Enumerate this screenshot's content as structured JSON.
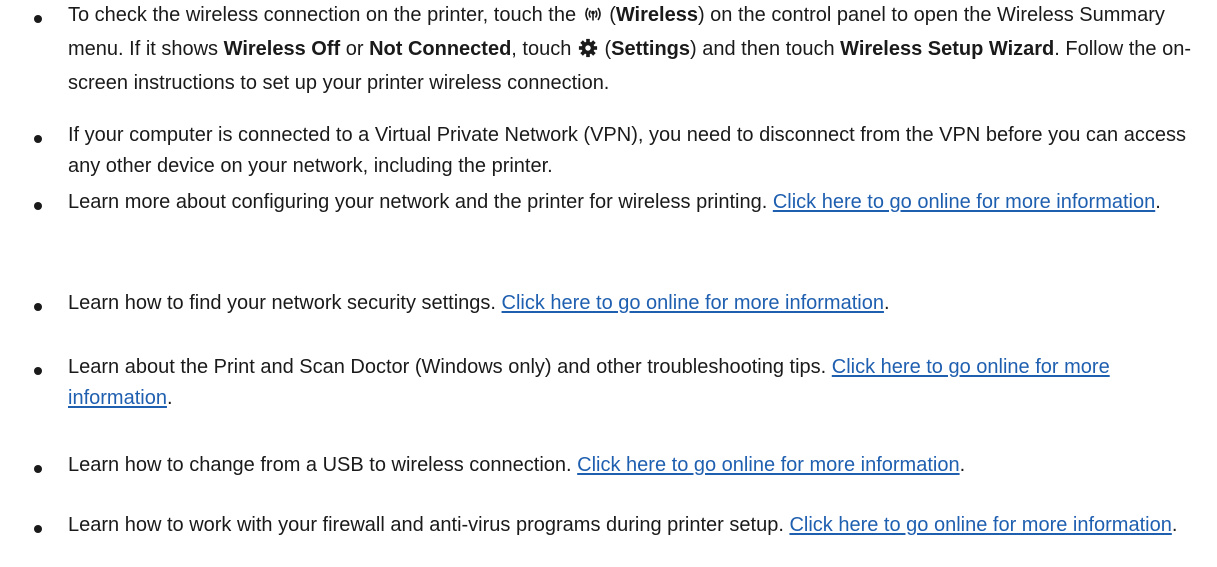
{
  "colors": {
    "text": "#1a1a1a",
    "link": "#1f5fb0"
  },
  "bullets": [
    {
      "t1": "To check the wireless connection on the printer, touch the ",
      "icon_wireless": "wireless-icon",
      "t2": " (",
      "b1": "Wireless",
      "t3": ") on the control panel to open the Wireless Summary menu. If it shows ",
      "b2": "Wireless Off",
      "t4": " or ",
      "b3": "Not Connected",
      "t5": ", touch ",
      "icon_settings": "settings-gear-icon",
      "t6": " (",
      "b4": "Settings",
      "t7": ") and then touch ",
      "b5": "Wireless Setup Wizard",
      "t8": ". Follow the on-screen instructions to set up your printer wireless connection."
    },
    {
      "text": "If your computer is connected to a Virtual Private Network (VPN), you need to disconnect from the VPN before you can access any other device on your network, including the printer."
    },
    {
      "text": "Learn more about configuring your network and the printer for wireless printing. ",
      "link": "Click here to go online for more information",
      "end": "."
    },
    {
      "text": "Learn how to find your network security settings. ",
      "link": "Click here to go online for more information",
      "end": "."
    },
    {
      "text": "Learn about the Print and Scan Doctor (Windows only) and other troubleshooting tips. ",
      "link": "Click here to go online for more information",
      "end": "."
    },
    {
      "text": "Learn how to change from a USB to wireless connection. ",
      "link": "Click here to go online for more information",
      "end": "."
    },
    {
      "text": "Learn how to work with your firewall and anti-virus programs during printer setup. ",
      "link": "Click here to go online for more information",
      "end": "."
    }
  ]
}
